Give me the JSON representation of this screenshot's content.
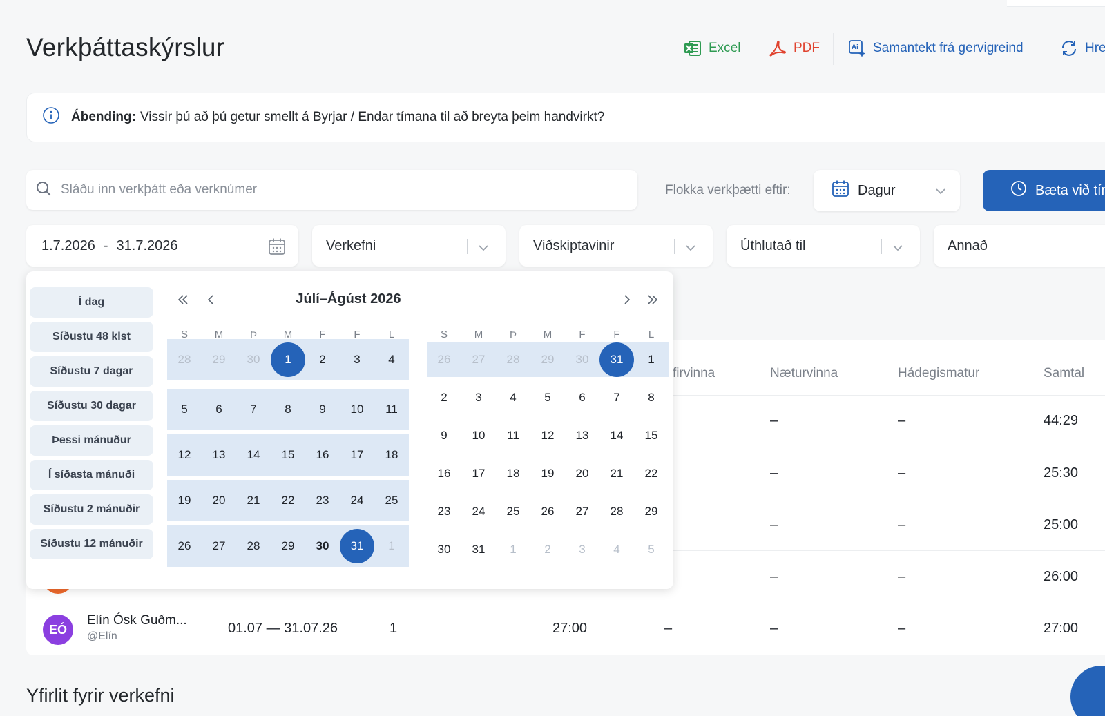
{
  "page": {
    "title": "Verkþáttaskýrslur"
  },
  "toolbar": {
    "excel": "Excel",
    "pdf": "PDF",
    "ai_summary": "Samantekt frá gervigreind",
    "refresh": "Hre"
  },
  "tip": {
    "label": "Ábending:",
    "text": "Vissir þú að þú getur smellt á Byrjar / Endar tímana til að breyta þeim handvirkt?"
  },
  "search": {
    "placeholder": "Sláðu inn verkþátt eða verknúmer"
  },
  "grouping": {
    "label": "Flokka verkþætti eftir:",
    "value": "Dagur"
  },
  "add_button": {
    "label": "Bæta við tím"
  },
  "filters": {
    "date_from": "1.7.2026",
    "date_sep": "-",
    "date_to": "31.7.2026",
    "verkefni": "Verkefni",
    "vidskiptavinir": "Viðskiptavinir",
    "uthlutad": "Úthlutað til",
    "annad": "Annað"
  },
  "picker": {
    "presets": [
      "Í dag",
      "Síðustu 48 klst",
      "Síðustu 7 dagar",
      "Síðustu 30 dagar",
      "Þessi mánuður",
      "Í síðasta mánuði",
      "Síðustu 2 mánuðir",
      "Síðustu 12 mánuðir"
    ],
    "title": "Júlí–Ágúst 2026",
    "weekdays": [
      "S",
      "M",
      "Þ",
      "M",
      "F",
      "F",
      "L"
    ],
    "month1_weeks": [
      [
        {
          "d": "28",
          "m": 1
        },
        {
          "d": "29",
          "m": 1
        },
        {
          "d": "30",
          "m": 1
        },
        {
          "d": "1",
          "s": 1
        },
        {
          "d": "2"
        },
        {
          "d": "3"
        },
        {
          "d": "4"
        }
      ],
      [
        {
          "d": "5"
        },
        {
          "d": "6"
        },
        {
          "d": "7"
        },
        {
          "d": "8"
        },
        {
          "d": "9"
        },
        {
          "d": "10"
        },
        {
          "d": "11"
        }
      ],
      [
        {
          "d": "12"
        },
        {
          "d": "13"
        },
        {
          "d": "14"
        },
        {
          "d": "15"
        },
        {
          "d": "16"
        },
        {
          "d": "17"
        },
        {
          "d": "18"
        }
      ],
      [
        {
          "d": "19"
        },
        {
          "d": "20"
        },
        {
          "d": "21"
        },
        {
          "d": "22"
        },
        {
          "d": "23"
        },
        {
          "d": "24"
        },
        {
          "d": "25"
        }
      ],
      [
        {
          "d": "26"
        },
        {
          "d": "27"
        },
        {
          "d": "28"
        },
        {
          "d": "29"
        },
        {
          "d": "30",
          "b": 1
        },
        {
          "d": "31",
          "s": 1
        },
        {
          "d": "1",
          "m": 1
        }
      ]
    ],
    "month2_weeks": [
      [
        {
          "d": "26",
          "m": 1
        },
        {
          "d": "27",
          "m": 1
        },
        {
          "d": "28",
          "m": 1
        },
        {
          "d": "29",
          "m": 1
        },
        {
          "d": "30",
          "m": 1
        },
        {
          "d": "31",
          "s": 1
        },
        {
          "d": "1"
        }
      ],
      [
        {
          "d": "2"
        },
        {
          "d": "3"
        },
        {
          "d": "4"
        },
        {
          "d": "5"
        },
        {
          "d": "6"
        },
        {
          "d": "7"
        },
        {
          "d": "8"
        }
      ],
      [
        {
          "d": "9"
        },
        {
          "d": "10"
        },
        {
          "d": "11"
        },
        {
          "d": "12"
        },
        {
          "d": "13"
        },
        {
          "d": "14"
        },
        {
          "d": "15"
        }
      ],
      [
        {
          "d": "16"
        },
        {
          "d": "17"
        },
        {
          "d": "18"
        },
        {
          "d": "19"
        },
        {
          "d": "20"
        },
        {
          "d": "21"
        },
        {
          "d": "22"
        }
      ],
      [
        {
          "d": "23"
        },
        {
          "d": "24"
        },
        {
          "d": "25"
        },
        {
          "d": "26"
        },
        {
          "d": "27"
        },
        {
          "d": "28"
        },
        {
          "d": "29"
        }
      ],
      [
        {
          "d": "30"
        },
        {
          "d": "31"
        },
        {
          "d": "1",
          "m": 1
        },
        {
          "d": "2",
          "m": 1
        },
        {
          "d": "3",
          "m": 1
        },
        {
          "d": "4",
          "m": 1
        },
        {
          "d": "5",
          "m": 1
        }
      ]
    ]
  },
  "table": {
    "headers": {
      "yfirvinna": "firvinna",
      "naeturvinna": "Næturvinna",
      "hadegismatur": "Hádegismatur",
      "samtals": "Samtal"
    },
    "rows": [
      {
        "naetur": "–",
        "hadegi": "–",
        "samtals": "44:29"
      },
      {
        "naetur": "–",
        "hadegi": "–",
        "samtals": "25:30"
      },
      {
        "naetur": "–",
        "hadegi": "–",
        "samtals": "25:00"
      },
      {
        "naetur": "–",
        "hadegi": "–",
        "samtals": "26:00"
      },
      {
        "initials": "EÓ",
        "name": "Elín Ósk Guðm...",
        "handle": "@Elín",
        "period": "01.07 — 31.07.26",
        "count": "1",
        "hours": "27:00",
        "yfir": "–",
        "naetur": "–",
        "hadegi": "–",
        "samtals": "27:00"
      }
    ]
  },
  "section": {
    "title": "Yfirlit fyrir verkefni"
  },
  "colors": {
    "primary": "#2563b8",
    "range": "#dde8f5",
    "preset_bg": "#eaf0f6",
    "excel": "#2e9a52",
    "pdf": "#e0432f",
    "avatar": "#8b3fe0"
  }
}
